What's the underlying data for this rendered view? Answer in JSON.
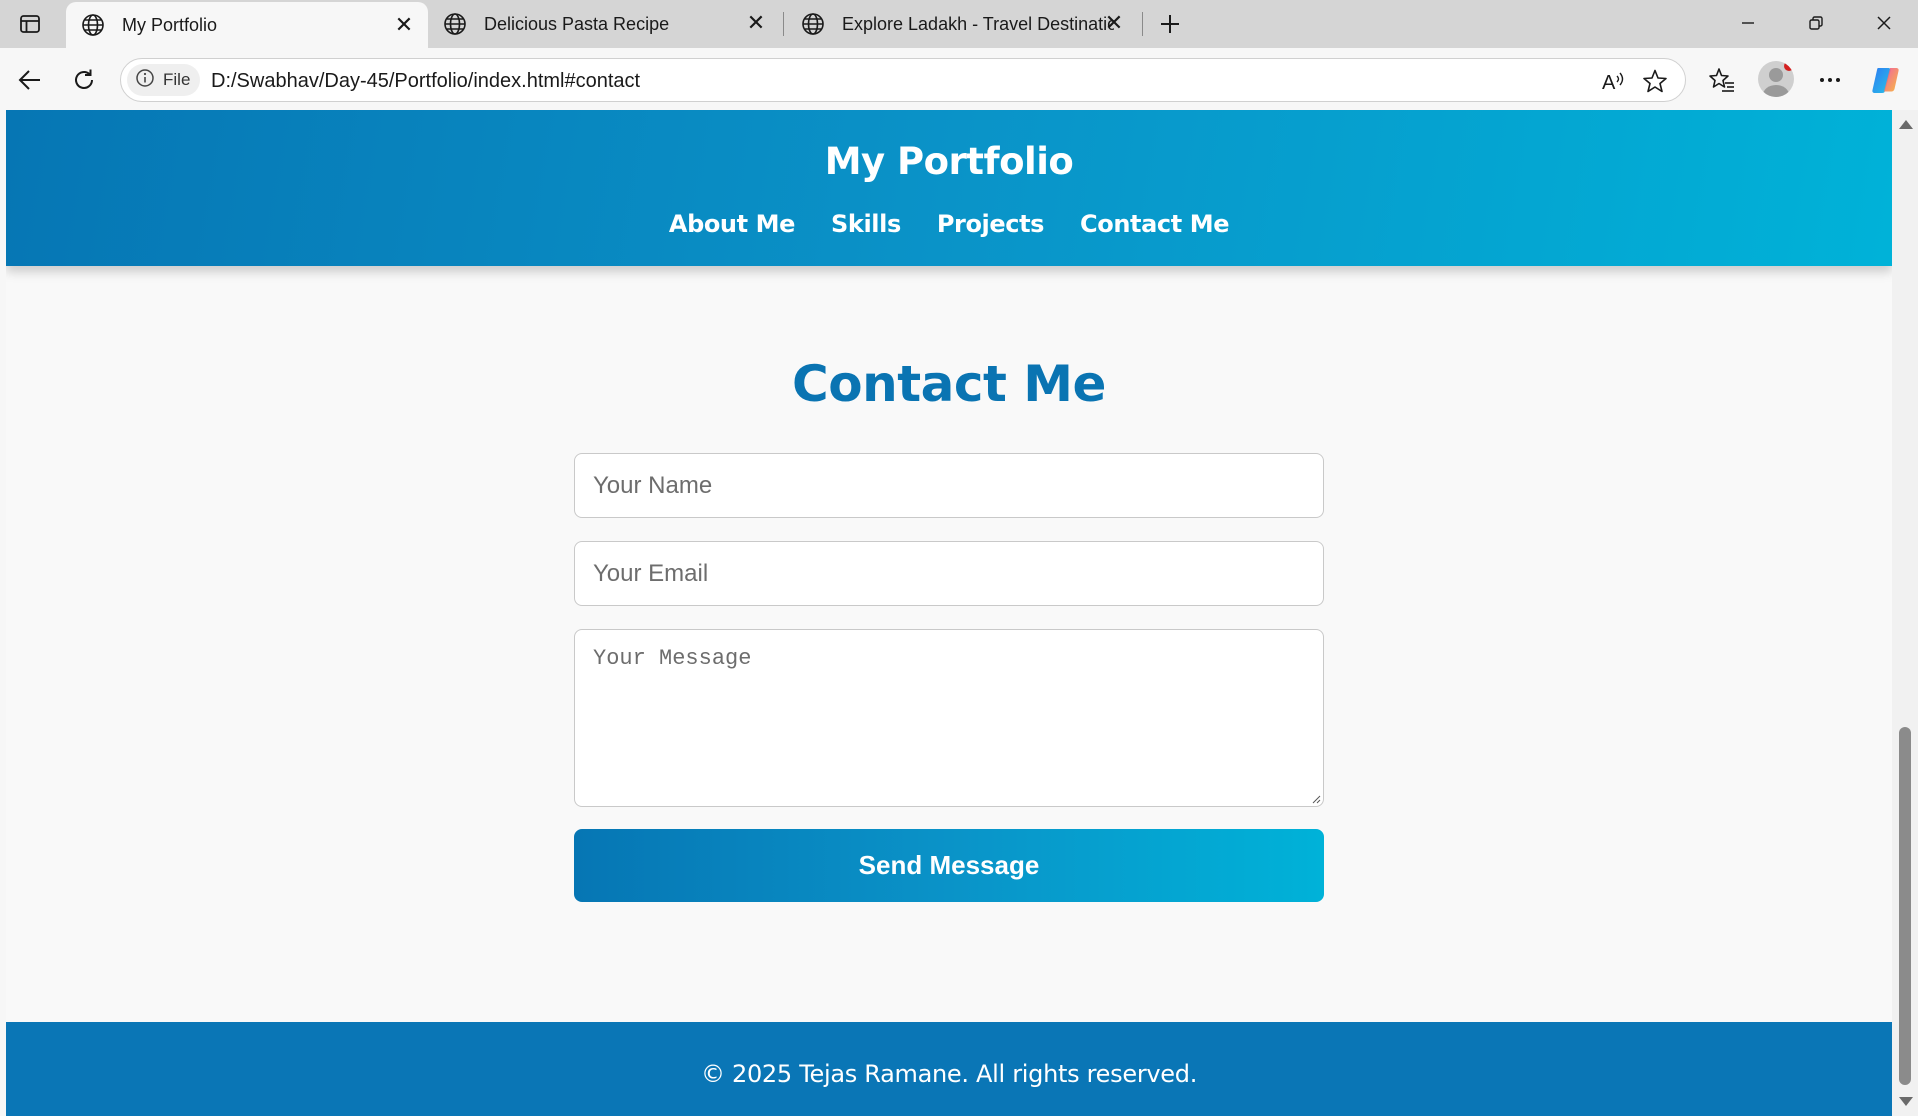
{
  "browser": {
    "tabs": [
      {
        "title": "My Portfolio",
        "active": true
      },
      {
        "title": "Delicious Pasta Recipe",
        "active": false
      },
      {
        "title": "Explore Ladakh - Travel Destinatio",
        "active": false
      }
    ],
    "address": {
      "security_chip": "File",
      "url": "D:/Swabhav/Day-45/Portfolio/index.html#contact"
    },
    "icons": {
      "tab_actions": "tab-actions-icon",
      "globe": "globe-icon",
      "close": "close-icon",
      "new_tab": "plus-icon",
      "back": "back-arrow-icon",
      "reload": "reload-icon",
      "info": "info-icon",
      "read_aloud": "read-aloud-icon",
      "favorite": "star-icon",
      "favorites": "favorites-icon",
      "profile": "profile-avatar",
      "more": "more-icon",
      "copilot": "copilot-icon"
    }
  },
  "page": {
    "header": {
      "title": "My Portfolio",
      "nav": [
        "About Me",
        "Skills",
        "Projects",
        "Contact Me"
      ]
    },
    "contact": {
      "heading": "Contact Me",
      "name_placeholder": "Your Name",
      "email_placeholder": "Your Email",
      "message_placeholder": "Your Message",
      "submit_label": "Send Message"
    },
    "footer": {
      "text": "© 2025 Tejas Ramane. All rights reserved."
    },
    "colors": {
      "primary": "#0a76b6",
      "gradient_start": "#0676b4",
      "gradient_end": "#00b2d8",
      "heading": "#0a74b2"
    }
  }
}
